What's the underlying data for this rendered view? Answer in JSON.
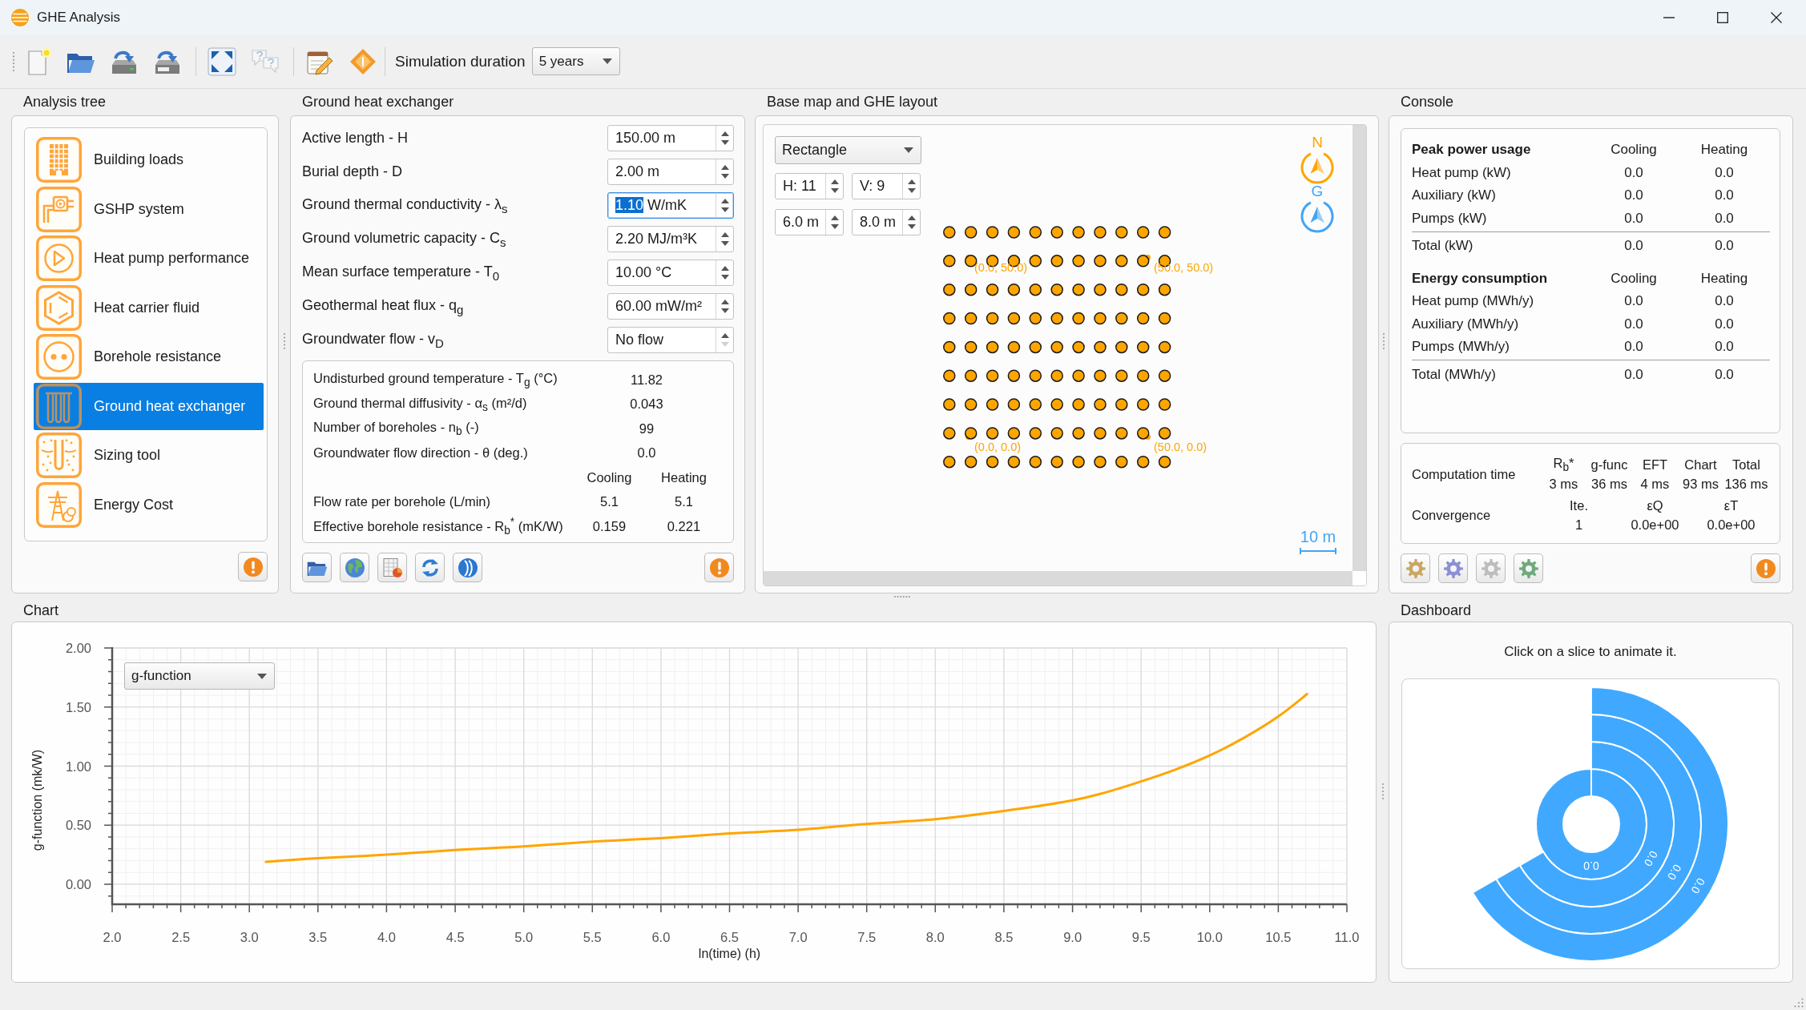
{
  "window": {
    "title": "GHE Analysis"
  },
  "toolbar": {
    "groups": [
      {
        "buttons": [
          {
            "kind": "new",
            "disabled": false
          },
          {
            "kind": "open",
            "disabled": false
          },
          {
            "kind": "save",
            "disabled": false
          },
          {
            "kind": "saveas",
            "disabled": false
          }
        ]
      },
      {
        "buttons": [
          {
            "kind": "fit",
            "disabled": false
          },
          {
            "kind": "help",
            "disabled": true
          }
        ]
      },
      {
        "buttons": [
          {
            "kind": "edit",
            "disabled": false
          },
          {
            "kind": "diamond",
            "disabled": false
          }
        ]
      }
    ],
    "duration_label": "Simulation duration",
    "duration_value": "5 years"
  },
  "analysis_tree": {
    "title": "Analysis tree",
    "items": [
      {
        "label": "Building loads",
        "kind": "building",
        "selected": false
      },
      {
        "label": "GSHP system",
        "kind": "system",
        "selected": false
      },
      {
        "label": "Heat pump performance",
        "kind": "pump",
        "selected": false
      },
      {
        "label": "Heat carrier fluid",
        "kind": "fluid",
        "selected": false
      },
      {
        "label": "Borehole resistance",
        "kind": "borehole",
        "selected": false
      },
      {
        "label": "Ground heat exchanger",
        "kind": "exchanger",
        "selected": true
      },
      {
        "label": "Sizing tool",
        "kind": "sizing",
        "selected": false
      },
      {
        "label": "Energy Cost",
        "kind": "cost",
        "selected": false
      }
    ]
  },
  "ground_heat_exchanger": {
    "title": "Ground heat exchanger",
    "parameters": [
      {
        "label": "Active length - H",
        "value": "150.00",
        "unit": "m",
        "selected": false,
        "down_disabled": false
      },
      {
        "label": "Burial depth - D",
        "value": "2.00",
        "unit": "m",
        "selected": false,
        "down_disabled": false
      },
      {
        "label": "Ground thermal conductivity - λ$_{s}$",
        "value": "1.10",
        "unit": "W/mK",
        "selected": true,
        "down_disabled": false
      },
      {
        "label": "Ground volumetric capacity - C$_{s}$",
        "value": "2.20",
        "unit": "MJ/m³K",
        "selected": false,
        "down_disabled": false
      },
      {
        "label": "Mean surface temperature - T$_{0}$",
        "value": "10.00",
        "unit": "°C",
        "selected": false,
        "down_disabled": false
      },
      {
        "label": "Geothermal heat flux - q$_{g}$",
        "value": "60.00",
        "unit": "mW/m²",
        "selected": false,
        "down_disabled": false
      },
      {
        "label": "Groundwater flow - v$_{D}$",
        "value": "No flow",
        "selected": false,
        "down_disabled": true
      }
    ],
    "results": [
      {
        "label": "Undisturbed ground temperature - T$_{g}$ (°C)",
        "value": "11.82"
      },
      {
        "label": "Ground thermal diffusivity - α$_{s}$ (m²/d)",
        "value": "0.043"
      },
      {
        "label": "Number of boreholes - n$_{b}$ (-)",
        "value": "99"
      },
      {
        "label": "Groundwater flow direction - θ (deg.)",
        "value": "0.0"
      }
    ],
    "flow_table": {
      "columns": [
        "Cooling",
        "Heating"
      ],
      "rows": [
        {
          "label": "Flow rate per borehole (L/min)",
          "values": [
            "5.1",
            "5.1"
          ]
        },
        {
          "label": "Effective borehole resistance - R$_{b}$$^{*}$ (mK/W)",
          "values": [
            "0.159",
            "0.221"
          ]
        }
      ]
    },
    "tools": [
      {
        "kind": "open"
      },
      {
        "kind": "globe"
      },
      {
        "kind": "report"
      },
      {
        "kind": "refresh"
      },
      {
        "kind": "disc"
      }
    ]
  },
  "base_map": {
    "title": "Base map and GHE layout",
    "shape": "Rectangle",
    "counts": [
      "H: 11",
      "V: 9"
    ],
    "spacings": [
      "6.0 m",
      "8.0 m"
    ],
    "corner_labels": [
      "(0.0, 50.0)",
      "(50.0, 50.0)",
      "(0.0, 0.0)",
      "(50.0, 0.0)"
    ],
    "compasses": [
      {
        "letter": "N",
        "kind": "north"
      },
      {
        "letter": "G",
        "kind": "grid"
      }
    ],
    "scale_label": "10 m"
  },
  "console": {
    "title": "Console",
    "sections": [
      {
        "heading": "Peak power usage",
        "columns": [
          "Cooling",
          "Heating"
        ],
        "rows": [
          {
            "label": "Heat pump (kW)",
            "values": [
              "0.0",
              "0.0"
            ]
          },
          {
            "label": "Auxiliary (kW)",
            "values": [
              "0.0",
              "0.0"
            ]
          },
          {
            "label": "Pumps (kW)",
            "values": [
              "0.0",
              "0.0"
            ]
          }
        ],
        "total": {
          "label": "Total (kW)",
          "values": [
            "0.0",
            "0.0"
          ]
        }
      },
      {
        "heading": "Energy consumption",
        "columns": [
          "Cooling",
          "Heating"
        ],
        "rows": [
          {
            "label": "Heat pump (MWh/y)",
            "values": [
              "0.0",
              "0.0"
            ]
          },
          {
            "label": "Auxiliary (MWh/y)",
            "values": [
              "0.0",
              "0.0"
            ]
          },
          {
            "label": "Pumps (MWh/y)",
            "values": [
              "0.0",
              "0.0"
            ]
          }
        ],
        "total": {
          "label": "Total (MWh/y)",
          "values": [
            "0.0",
            "0.0"
          ]
        }
      }
    ],
    "computation": {
      "label": "Computation time",
      "columns": [
        {
          "heading": "R$_{b}$*",
          "value": "3 ms"
        },
        {
          "heading": "g-func",
          "value": "36 ms"
        },
        {
          "heading": "EFT",
          "value": "4 ms"
        },
        {
          "heading": "Chart",
          "value": "93 ms"
        },
        {
          "heading": "Total",
          "value": "136 ms"
        }
      ]
    },
    "convergence": {
      "label": "Convergence",
      "columns": [
        {
          "heading": "Ite.",
          "value": "1"
        },
        {
          "heading": "εQ",
          "value": "0.0e+00"
        },
        {
          "heading": "εT",
          "value": "0.0e+00"
        }
      ]
    },
    "tools": [
      {
        "kind": "gear",
        "color": "#c9a765"
      },
      {
        "kind": "gear",
        "color": "#8a8fd6"
      },
      {
        "kind": "gear",
        "color": "#bdbdbd"
      },
      {
        "kind": "gear",
        "color": "#6fa97c"
      }
    ]
  },
  "chart": {
    "title": "Chart",
    "chart_data": {
      "type": "line",
      "xlabel": "ln(time) (h)",
      "ylabel": "g-function (mk/W)",
      "grid": true,
      "x": [
        3.12,
        3.5,
        4.0,
        4.5,
        5.0,
        5.5,
        6.0,
        6.5,
        7.0,
        7.5,
        8.0,
        8.5,
        9.0,
        9.25,
        9.5,
        9.75,
        10.0,
        10.25,
        10.5,
        10.71
      ],
      "series": [
        {
          "name": "g-function",
          "color": "#ffa500",
          "values": [
            0.19,
            0.22,
            0.25,
            0.29,
            0.32,
            0.36,
            0.39,
            0.43,
            0.46,
            0.51,
            0.55,
            0.62,
            0.71,
            0.78,
            0.87,
            0.97,
            1.09,
            1.24,
            1.42,
            1.61
          ]
        }
      ],
      "xlim": [
        2.0,
        11.0
      ],
      "ylim": [
        -0.17,
        2.0
      ],
      "xticks": [
        {
          "value": 2,
          "label": "2.0"
        },
        {
          "value": 2.5,
          "label": "2.5"
        },
        {
          "value": 3,
          "label": "3.0"
        },
        {
          "value": 3.5,
          "label": "3.5"
        },
        {
          "value": 4,
          "label": "4.0"
        },
        {
          "value": 4.5,
          "label": "4.5"
        },
        {
          "value": 5,
          "label": "5.0"
        },
        {
          "value": 5.5,
          "label": "5.5"
        },
        {
          "value": 6,
          "label": "6.0"
        },
        {
          "value": 6.5,
          "label": "6.5"
        },
        {
          "value": 7,
          "label": "7.0"
        },
        {
          "value": 7.5,
          "label": "7.5"
        },
        {
          "value": 8,
          "label": "8.0"
        },
        {
          "value": 8.5,
          "label": "8.5"
        },
        {
          "value": 9,
          "label": "9.0"
        },
        {
          "value": 9.5,
          "label": "9.5"
        },
        {
          "value": 10,
          "label": "10.0"
        },
        {
          "value": 10.5,
          "label": "10.5"
        },
        {
          "value": 11,
          "label": "11.0"
        }
      ],
      "yticks": [
        {
          "value": 0,
          "label": "0.00"
        },
        {
          "value": 0.5,
          "label": "0.50"
        },
        {
          "value": 1,
          "label": "1.00"
        },
        {
          "value": 1.5,
          "label": "1.50"
        },
        {
          "value": 2,
          "label": "2.00"
        }
      ]
    }
  },
  "dashboard": {
    "title": "Dashboard",
    "hint": "Click on a slice to animate it.",
    "rings": [
      {
        "label": "0.0"
      },
      {
        "label": "0.0"
      },
      {
        "label": "0.0"
      },
      {
        "label": "0.0"
      }
    ]
  }
}
